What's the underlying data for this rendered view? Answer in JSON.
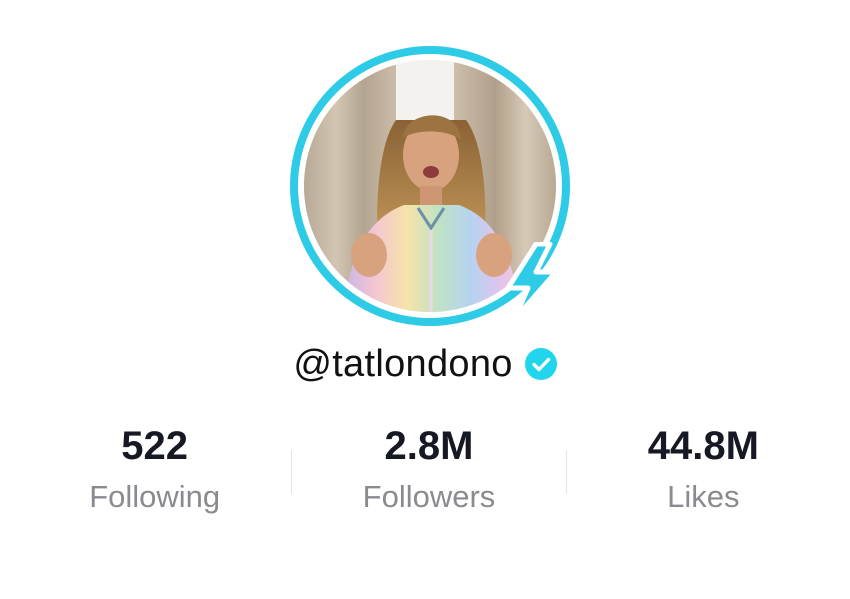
{
  "profile": {
    "username": "@tatlondono",
    "verified": true
  },
  "stats": {
    "following_value": "522",
    "following_label": "Following",
    "followers_value": "2.8M",
    "followers_label": "Followers",
    "likes_value": "44.8M",
    "likes_label": "Likes"
  },
  "icons": {
    "live_badge": "live-lightning-icon",
    "verified": "verified-check-icon"
  },
  "colors": {
    "ring": "#2ecbe6",
    "verified": "#20d5ec",
    "value_text": "#161823",
    "label_text": "#8a8b91"
  }
}
